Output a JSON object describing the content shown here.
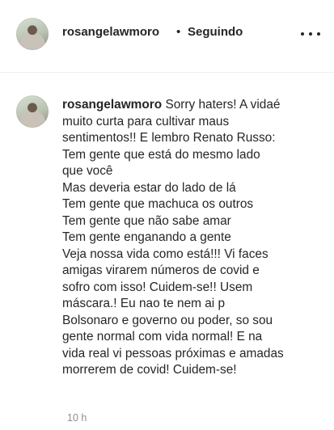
{
  "post": {
    "username": "rosangelawmoro",
    "separator": "•",
    "follow_status": "Seguindo"
  },
  "comment": {
    "username": "rosangelawmoro",
    "first_line_text": "Sorry haters! A vidaé",
    "lines": [
      "muito curta para cultivar maus",
      "sentimentos!! E lembro Renato Russo:",
      "Tem gente que está do mesmo lado",
      "que você",
      "Mas deveria estar do lado de lá",
      "Tem gente que machuca os outros",
      "Tem gente que não sabe amar",
      "Tem gente enganando a gente",
      "Veja nossa vida como está!!! Vi faces",
      "amigas virarem números de covid e",
      "sofro com isso! Cuidem-se!! Usem",
      "máscara.! Eu nao te nem ai p",
      "Bolsonaro e governo ou poder, so sou",
      "gente normal com vida normal! E na",
      "vida real vi pessoas próximas e amadas",
      "morrerem de covid! Cuidem-se!"
    ],
    "timestamp": "10 h"
  },
  "icons": {
    "more": "more-horizontal-icon"
  }
}
